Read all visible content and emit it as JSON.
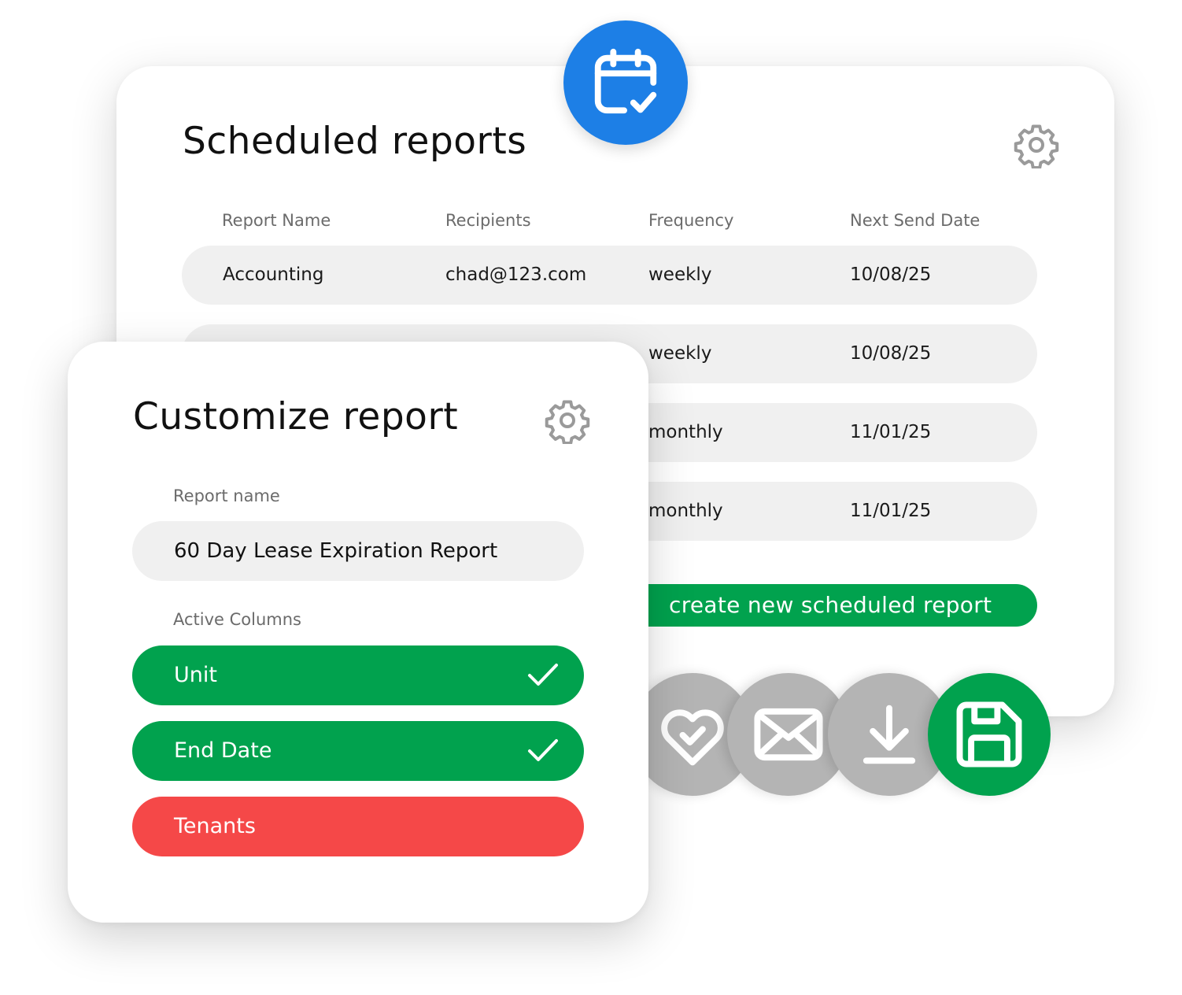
{
  "scheduled_reports": {
    "title": "Scheduled reports",
    "columns": [
      "Report Name",
      "Recipients",
      "Frequency",
      "Next Send Date"
    ],
    "rows": [
      {
        "name": "Accounting",
        "recipients": "chad@123.com",
        "frequency": "weekly",
        "next_send": "10/08/25"
      },
      {
        "frequency": "weekly",
        "next_send": "10/08/25"
      },
      {
        "frequency": "monthly",
        "next_send": "11/01/25"
      },
      {
        "frequency": "monthly",
        "next_send": "11/01/25"
      }
    ],
    "create_label": "create new scheduled report"
  },
  "customize_report": {
    "title": "Customize report",
    "report_name_label": "Report name",
    "report_name_value": "60 Day Lease Expiration Report",
    "active_columns_label": "Active Columns",
    "columns": [
      {
        "label": "Unit",
        "active": true
      },
      {
        "label": "End Date",
        "active": true
      },
      {
        "label": "Tenants",
        "active": false
      }
    ]
  },
  "actions": [
    "favorite-icon",
    "email-icon",
    "download-icon",
    "save-icon"
  ],
  "colors": {
    "accent_green": "#01a24e",
    "inactive_red": "#f54848",
    "calendar_blue": "#1d7fe6",
    "action_gray": "#b4b4b4",
    "row_bg": "#f0f0f0"
  }
}
